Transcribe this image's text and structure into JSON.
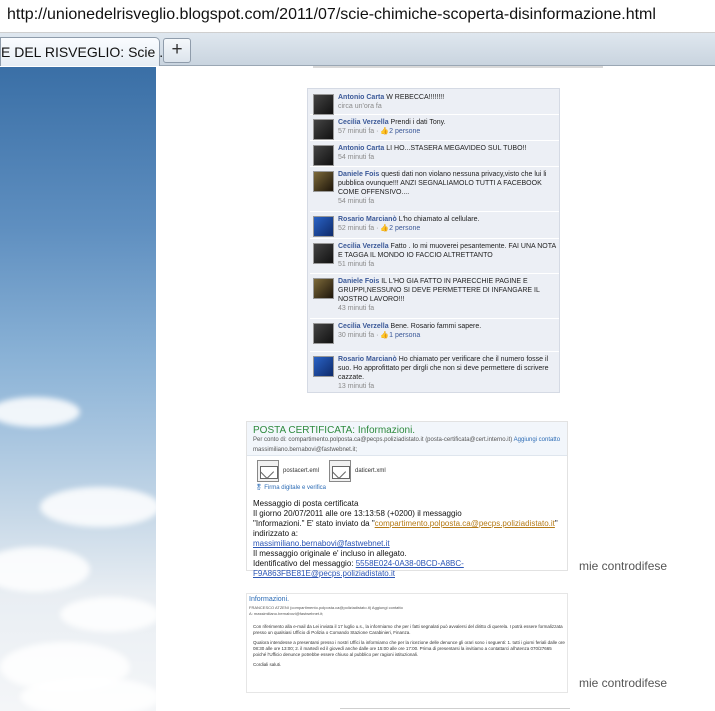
{
  "browser": {
    "url": "http://unionedelrisveglio.blogspot.com/2011/07/scie-chimiche-scoperta-disinformazione.html",
    "tab_title": "E DEL RISVEGLIO: Scie ...",
    "new_tab_label": "+"
  },
  "facebook_comments": [
    {
      "author": "Antonio Carta",
      "text": "W REBECCA!!!!!!!!",
      "time": "circa un'ora fa",
      "likes": ""
    },
    {
      "author": "Cecilia Verzella",
      "text": "Prendi i dati Tony.",
      "time": "57 minuti fa · ",
      "likes": "2 persone"
    },
    {
      "author": "Antonio Carta",
      "text": "LI HO...STASERA MEGAVIDEO SUL TUBO!!",
      "time": "54 minuti fa",
      "likes": ""
    },
    {
      "author": "Daniele Fois",
      "text": "questi dati non violano nessuna privacy,visto che lui li pubblica ovunque!!! ANZI SEGNALIAMOLO TUTTI A FACEBOOK COME OFFENSIVO....",
      "time": "54 minuti fa",
      "likes": ""
    },
    {
      "author": "Rosario Marcianò",
      "text": "L'ho chiamato al cellulare.",
      "time": "52 minuti fa · ",
      "likes": "2 persone"
    },
    {
      "author": "Cecilia Verzella",
      "text": "Fatto . Io mi muoverei pesantemente. FAI UNA NOTA E TAGGA IL MONDO IO FACCIO ALTRETTANTO",
      "time": "51 minuti fa",
      "likes": ""
    },
    {
      "author": "Daniele Fois",
      "text": "IL L'HO GIA FATTO IN PARECCHIE PAGINE E GRUPPI,NESSUNO SI DEVE PERMETTERE DI INFANGARE IL NOSTRO LAVORO!!!",
      "time": "43 minuti fa",
      "likes": ""
    },
    {
      "author": "Cecilia Verzella",
      "text": "Bene. Rosario fammi sapere.",
      "time": "30 minuti fa · ",
      "likes": "1 persona"
    },
    {
      "author": "Rosario Marcianò",
      "text": "Ho chiamato per verificare che il numero fosse il suo. Ho approfittato per dirgli che non si deve permettere di scrivere cazzate.",
      "time": "13 minuti fa",
      "likes": ""
    }
  ],
  "pec": {
    "title": "POSTA CERTIFICATA: Informazioni.",
    "from_prefix": "Per conto di: compartimento.polposta.ca@pecps.poliziadistato.it",
    "from_addr": "(posta-certificata@cert.interno.it)",
    "reply": "Aggiungi contatto",
    "to": "massimiliano.bernabovi@fastwebnet.it;",
    "attachments": [
      "postacert.eml",
      "daticert.xml"
    ],
    "signature": "Firma digitale e verifica",
    "lines": [
      "Messaggio di posta certificata",
      "Il giorno 20/07/2011 alle ore 13:13:58 (+0200) il messaggio",
      "\"Informazioni.\" E' stato inviato da \"",
      "compartimento.polposta.ca@pecps.poliziadistato.it",
      "\"",
      "indirizzato a:",
      "massimiliano.bernabovi@fastwebnet.it",
      "Il messaggio originale e' incluso in allegato.",
      "Identificativo del messaggio: ",
      "5558E024-0A38-0BCD-A8BC-F9A863FBE81E@pecps.poliziadistato.it"
    ]
  },
  "side_labels": [
    "mie controdifese",
    "mie controdifese"
  ],
  "info": {
    "title": "Informazioni.",
    "from": "FRANCESCO ATZENI (compartimento.polposta.ca@poliziadistato.it)   Aggiungi contatto",
    "to": "A: massimiliano.bernabovi@fastwebnet.it;",
    "paragraphs": [
      "Con riferimento alla e-mail da Lei inviata il 17 luglio u.s., la informiamo che per i fatti segnalati può avvalersi del diritto di querela. I potrà essere formalizzata presso un qualsiasi Ufficio di Polizia o Comando Stazione Carabinieri, Finanza.",
      "Qualora intendesse a presentarsi presso i nostri Uffici la informiamo che per la ricezione delle denunce gli orari sono i seguenti: 1. tutti i giorni feriali dalle ore 08:30 alle ore 13:00; 2. il martedì ed il giovedì anche dalle ore 15:00 alle ore 17:00. Prima di presentarsi la invitiamo a contattarci all'utenza 070/27665 poiché l'Ufficio denunce potrebbe essere chiuso al pubblico per ragioni istituzionali.",
      "Cordiali saluti."
    ]
  }
}
